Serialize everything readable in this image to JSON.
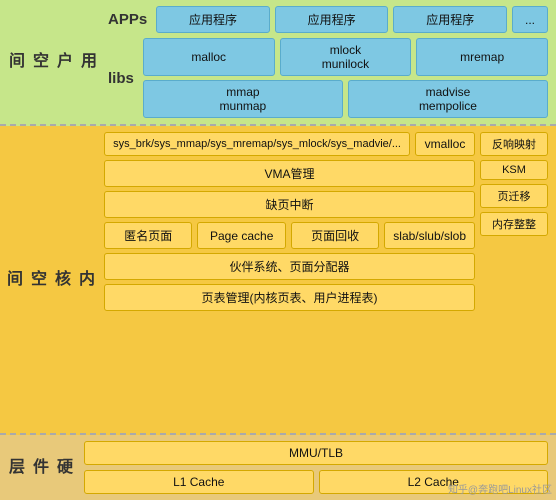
{
  "layers": {
    "user": {
      "label": "用\n户\n空\n间",
      "apps_label": "APPs",
      "apps_boxes": [
        "应用程序",
        "应用程序",
        "应用程序",
        "..."
      ],
      "libs_label": "libs",
      "libs_row1": [
        "malloc",
        "mlock\nmunilock",
        "mremap"
      ],
      "libs_row2": [
        "mmap\nmunmap",
        "madvise\nmempolice"
      ]
    },
    "kernel": {
      "label": "内\n核\n空\n间",
      "row1_left": "sys_brk/sys_mmap/sys_mremap/sys_mlock/sys_madvie/...",
      "row1_mid": "vmalloc",
      "row1_right": [
        "反响映射",
        "KSM",
        "页迁移",
        "内存整整"
      ],
      "row2": "VMA管理",
      "row3": "缺页中断",
      "row4_boxes": [
        "匿名页面",
        "Page cache",
        "页面回收",
        "slab/slub/slob"
      ],
      "row5": "伙伴系统、页面分配器",
      "row6": "页表管理(内核页表、用户进程表)"
    },
    "hardware": {
      "label": "硬\n件\n层",
      "row1": "MMU/TLB",
      "row2_boxes": [
        "L1 Cache",
        "L2 Cache"
      ]
    }
  },
  "watermark": "知乎@奔跑吧Linux社区"
}
